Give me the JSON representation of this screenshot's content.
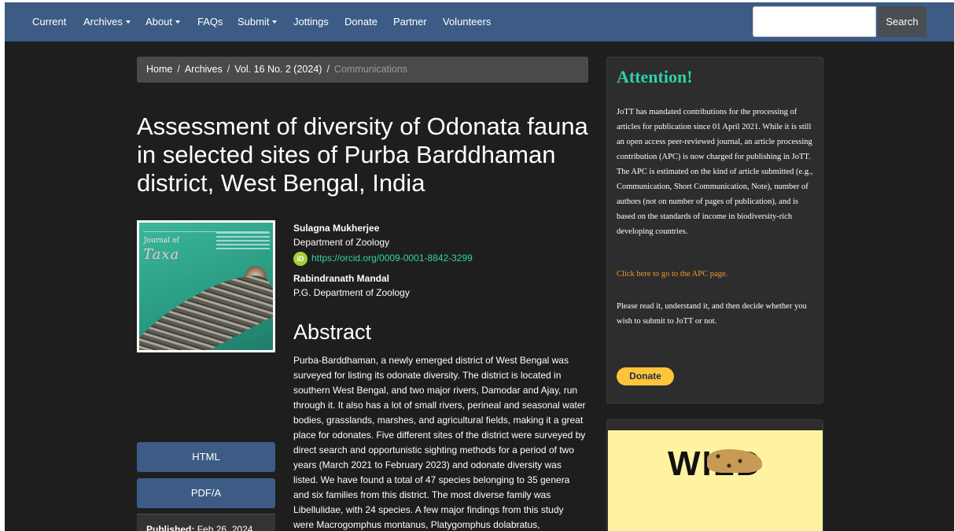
{
  "nav": {
    "items": [
      {
        "label": "Current",
        "has_caret": false
      },
      {
        "label": "Archives",
        "has_caret": true
      },
      {
        "label": "About",
        "has_caret": true
      },
      {
        "label": "FAQs",
        "has_caret": false
      },
      {
        "label": "Submit",
        "has_caret": true
      },
      {
        "label": "Jottings",
        "has_caret": false
      },
      {
        "label": "Donate",
        "has_caret": false
      },
      {
        "label": "Partner",
        "has_caret": false
      },
      {
        "label": "Volunteers",
        "has_caret": false
      }
    ],
    "search_value": "",
    "search_button": "Search"
  },
  "breadcrumb": {
    "home": "Home",
    "archives": "Archives",
    "issue": "Vol. 16 No. 2 (2024)",
    "current": "Communications",
    "separator": "/"
  },
  "article": {
    "title": "Assessment of diversity of Odonata fauna in selected sites of Purba Barddhaman district, West Bengal, India",
    "cover": {
      "journal_line": "Journal of",
      "journal_name": "Taxa"
    },
    "authors": [
      {
        "name": "Sulagna Mukherjee",
        "affiliation": "Department of Zoology",
        "orcid": "https://orcid.org/0009-0001-8842-3299"
      },
      {
        "name": "Rabindranath Mandal",
        "affiliation": "P.G. Department of Zoology"
      }
    ],
    "orcid_icon": "iD",
    "abstract_heading": "Abstract",
    "abstract": "Purba-Barddhaman, a newly emerged district of West Bengal was surveyed for listing its odonate diversity. The district is located in southern West Bengal, and two major rivers, Damodar and Ajay, run through it. It also has a lot of small rivers, perineal and seasonal water bodies, grasslands, marshes, and agricultural fields, making it a great place for odonates. Five different sites of the district were surveyed by direct search and opportunistic sighting methods for a period of two years (March 2021 to February 2023) and odonate diversity was listed. We have found a total of 47 species belonging to 35 genera and six families from this district. The most diverse family was Libellulidae, with 24 species. A few major findings from this study were Macrogomphus montanus, Platygomphus dolabratus, Lathrecista asiatica, Libellago",
    "galleys": [
      "HTML",
      "PDF/A"
    ],
    "published_label": "Published:",
    "published_date": "Feb 26, 2024"
  },
  "sidebar": {
    "attention_title": "Attention!",
    "attention_p1": "JoTT has mandated contributions for the processing of articles for publication since 01 April 2021.  While it is still an open access peer-reviewed journal, an article processing contribution (APC) is now charged for publishing in JoTT.  The APC is estimated on the kind of article submitted (e.g., Communication, Short Communication, Note), number of authors (not on number of pages of publication), and is based on the standards of income in biodiversity-rich developing countries.",
    "apc_link": "Click here to go to the APC page.",
    "attention_p2": "Please read it, understand it, and then decide whether you wish to submit to JoTT or not.",
    "donate_label": "Donate",
    "ad_word": "WILD"
  },
  "colors": {
    "navbar": "#3c5c86",
    "background": "#1e1e1e",
    "accent_teal": "#2bd3a7",
    "link_orange": "#f7942e",
    "donate_yellow": "#ffc439",
    "ad_yellow": "#fff3a1"
  }
}
